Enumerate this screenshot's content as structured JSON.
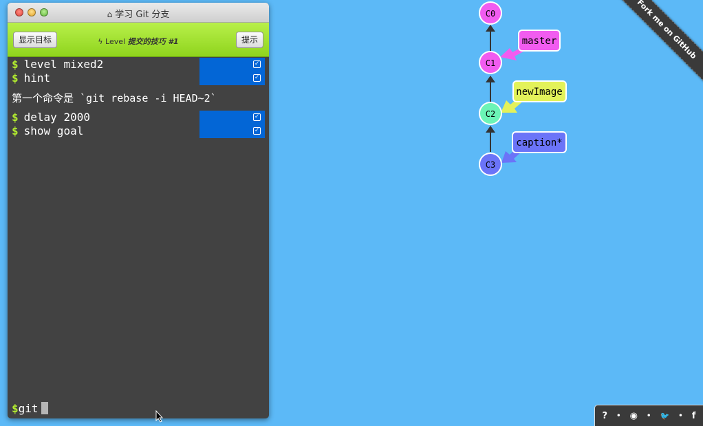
{
  "window": {
    "title": "学习 Git 分支",
    "goal_button": "显示目标",
    "hint_button": "提示",
    "level_prefix": "Level",
    "level_name": "提交的技巧 #1"
  },
  "terminal": {
    "commands_a": [
      {
        "text": "level mixed2"
      },
      {
        "text": "hint"
      }
    ],
    "info": "第一个命令是 `git rebase -i HEAD~2`",
    "commands_b": [
      {
        "text": "delay 2000"
      },
      {
        "text": "show goal"
      }
    ],
    "prompt": "git"
  },
  "tree": {
    "commits": [
      {
        "id": "C0",
        "color": "#f15cf0"
      },
      {
        "id": "C1",
        "color": "#f15cf0"
      },
      {
        "id": "C2",
        "color": "#6cf4b6"
      },
      {
        "id": "C3",
        "color": "#6b74f8"
      }
    ],
    "branches": [
      {
        "name": "master",
        "target": "C1",
        "color": "#f15cf0"
      },
      {
        "name": "newImage",
        "target": "C2",
        "color": "#e3f25a"
      },
      {
        "name": "caption*",
        "target": "C3",
        "color": "#6b74f8"
      }
    ]
  },
  "ribbon": "Fork me on GitHub",
  "footer": {
    "icons": [
      "help-icon",
      "globe-icon",
      "twitter-icon",
      "facebook-icon"
    ],
    "glyphs": [
      "?",
      "◉",
      "🐦",
      "f"
    ]
  }
}
